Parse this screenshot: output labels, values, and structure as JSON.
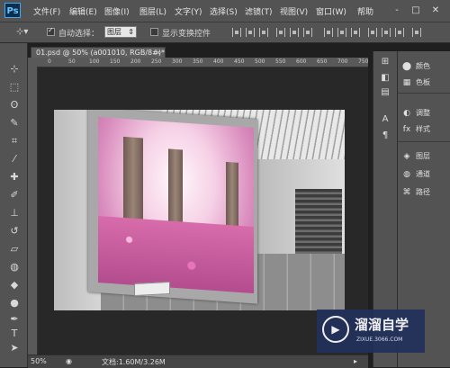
{
  "app": {
    "logo": "Ps"
  },
  "menu": [
    "文件(F)",
    "编辑(E)",
    "图像(I)",
    "图层(L)",
    "文字(Y)",
    "选择(S)",
    "滤镜(T)",
    "视图(V)",
    "窗口(W)",
    "帮助"
  ],
  "window_controls": [
    "-",
    "□",
    "✕"
  ],
  "options": {
    "auto_select_label": "自动选择：",
    "auto_select_checked": true,
    "layer_dropdown": "图层",
    "show_transform_label": "显示变换控件",
    "show_transform_checked": false
  },
  "document": {
    "tab_title": "01.psd @ 50% (a001010, RGB/8#)",
    "tab_modified": "*",
    "ruler_ticks": [
      "0",
      "50",
      "100",
      "150",
      "200",
      "250",
      "300",
      "350",
      "400",
      "450",
      "500",
      "550",
      "600",
      "650",
      "700",
      "750"
    ]
  },
  "status": {
    "zoom": "50%",
    "doc_info": "文档:1.60M/3.26M"
  },
  "panels": {
    "group1": [
      {
        "icon": "color-icon",
        "label": "颜色"
      },
      {
        "icon": "swatches-icon",
        "label": "色板"
      }
    ],
    "group2": [
      {
        "icon": "adjustments-icon",
        "label": "调整"
      },
      {
        "icon": "styles-icon",
        "label": "样式"
      }
    ],
    "group3": [
      {
        "icon": "layers-icon",
        "label": "图层"
      },
      {
        "icon": "channels-icon",
        "label": "通道"
      },
      {
        "icon": "paths-icon",
        "label": "路径"
      }
    ]
  },
  "watermark": {
    "title": "溜溜自学",
    "url": "ZIXUE.3066.COM"
  }
}
